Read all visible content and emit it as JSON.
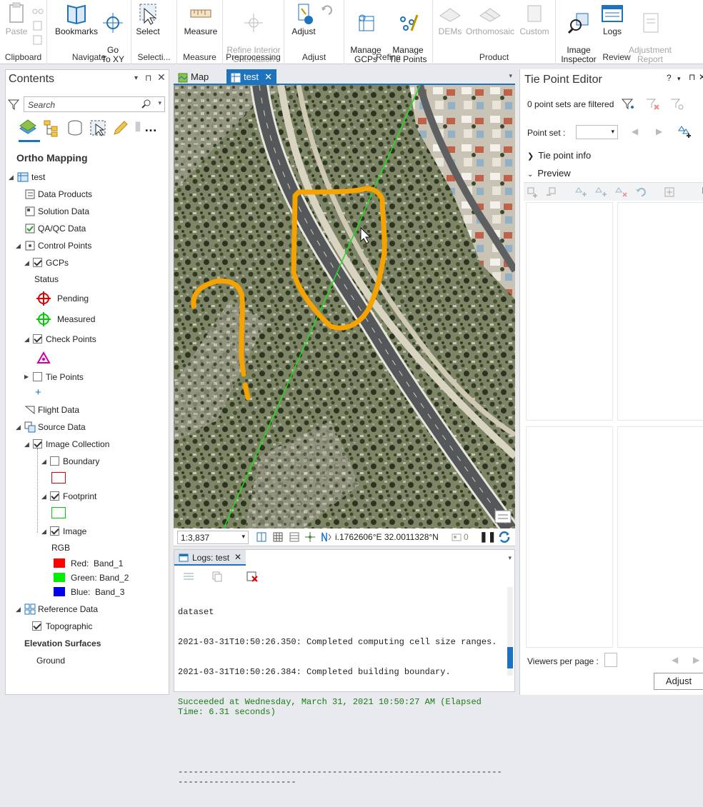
{
  "ribbon": {
    "groups": [
      {
        "name": "Clipboard",
        "buttons": [
          "Paste"
        ]
      },
      {
        "name": "Navigate",
        "buttons": [
          "Bookmarks",
          "Go\nTo XY"
        ]
      },
      {
        "name": "Selecti...",
        "buttons": [
          "Select"
        ]
      },
      {
        "name": "Measure",
        "buttons": [
          "Measure"
        ]
      },
      {
        "name": "Preprocessing",
        "buttons": [
          "Refine Interior\nOrientation"
        ]
      },
      {
        "name": "Adjust",
        "buttons": [
          "Adjust"
        ]
      },
      {
        "name": "Refine",
        "buttons": [
          "Manage\nGCPs",
          "Manage\nTie Points"
        ]
      },
      {
        "name": "Product",
        "buttons": [
          "DEMs",
          "Orthomosaic",
          "Custom"
        ]
      },
      {
        "name": "Review",
        "buttons": [
          "Image\nInspector",
          "Logs",
          "Adjustment\nReport"
        ]
      }
    ]
  },
  "contents": {
    "title": "Contents",
    "search_placeholder": "Search",
    "heading": "Ortho Mapping",
    "tree": [
      {
        "label": "test"
      },
      {
        "label": "Data Products"
      },
      {
        "label": "Solution Data"
      },
      {
        "label": "QA/QC Data"
      },
      {
        "label": "Control Points"
      },
      {
        "label": "GCPs"
      },
      {
        "label": "Status"
      },
      {
        "label": "Pending"
      },
      {
        "label": "Measured"
      },
      {
        "label": "Check Points"
      },
      {
        "label": "Tie Points"
      },
      {
        "label": "Flight Data"
      },
      {
        "label": "Source Data"
      },
      {
        "label": "Image Collection"
      },
      {
        "label": "Boundary"
      },
      {
        "label": "Footprint"
      },
      {
        "label": "Image"
      },
      {
        "label": "RGB"
      },
      {
        "label": "Red:  Band_1"
      },
      {
        "label": "Green: Band_2"
      },
      {
        "label": "Blue:  Band_3"
      },
      {
        "label": "Reference Data"
      },
      {
        "label": "Topographic"
      },
      {
        "label": "Elevation Surfaces"
      },
      {
        "label": "Ground"
      }
    ]
  },
  "map": {
    "tabs": [
      "Map",
      "test"
    ],
    "scale": "1:3,837",
    "coords": "i.1762606°E 32.0011328°N",
    "selected_count": "0"
  },
  "logs": {
    "tab": "Logs: test",
    "lines": [
      "dataset",
      "2021-03-31T10:50:26.350: Completed computing cell size ranges.",
      "2021-03-31T10:50:26.384: Completed building boundary."
    ],
    "success": "Succeeded at Wednesday, March 31, 2021 10:50:27 AM (Elapsed Time: 6.31 seconds)",
    "separator": "--------------------------------------------------------------------------------------"
  },
  "tie_point_editor": {
    "title": "Tie Point Editor",
    "filter_text": "0 point sets are filtered",
    "point_set_label": "Point set :",
    "tie_point_info": "Tie point info",
    "preview": "Preview",
    "viewers_label": "Viewers per page :",
    "adjust_button": "Adjust"
  },
  "colors": {
    "accent": "#1e73be",
    "annotation": "#f5a300",
    "flight_line": "#22dd22",
    "pending": "#e00000",
    "measured": "#00cc00",
    "check": "#cc00aa"
  }
}
